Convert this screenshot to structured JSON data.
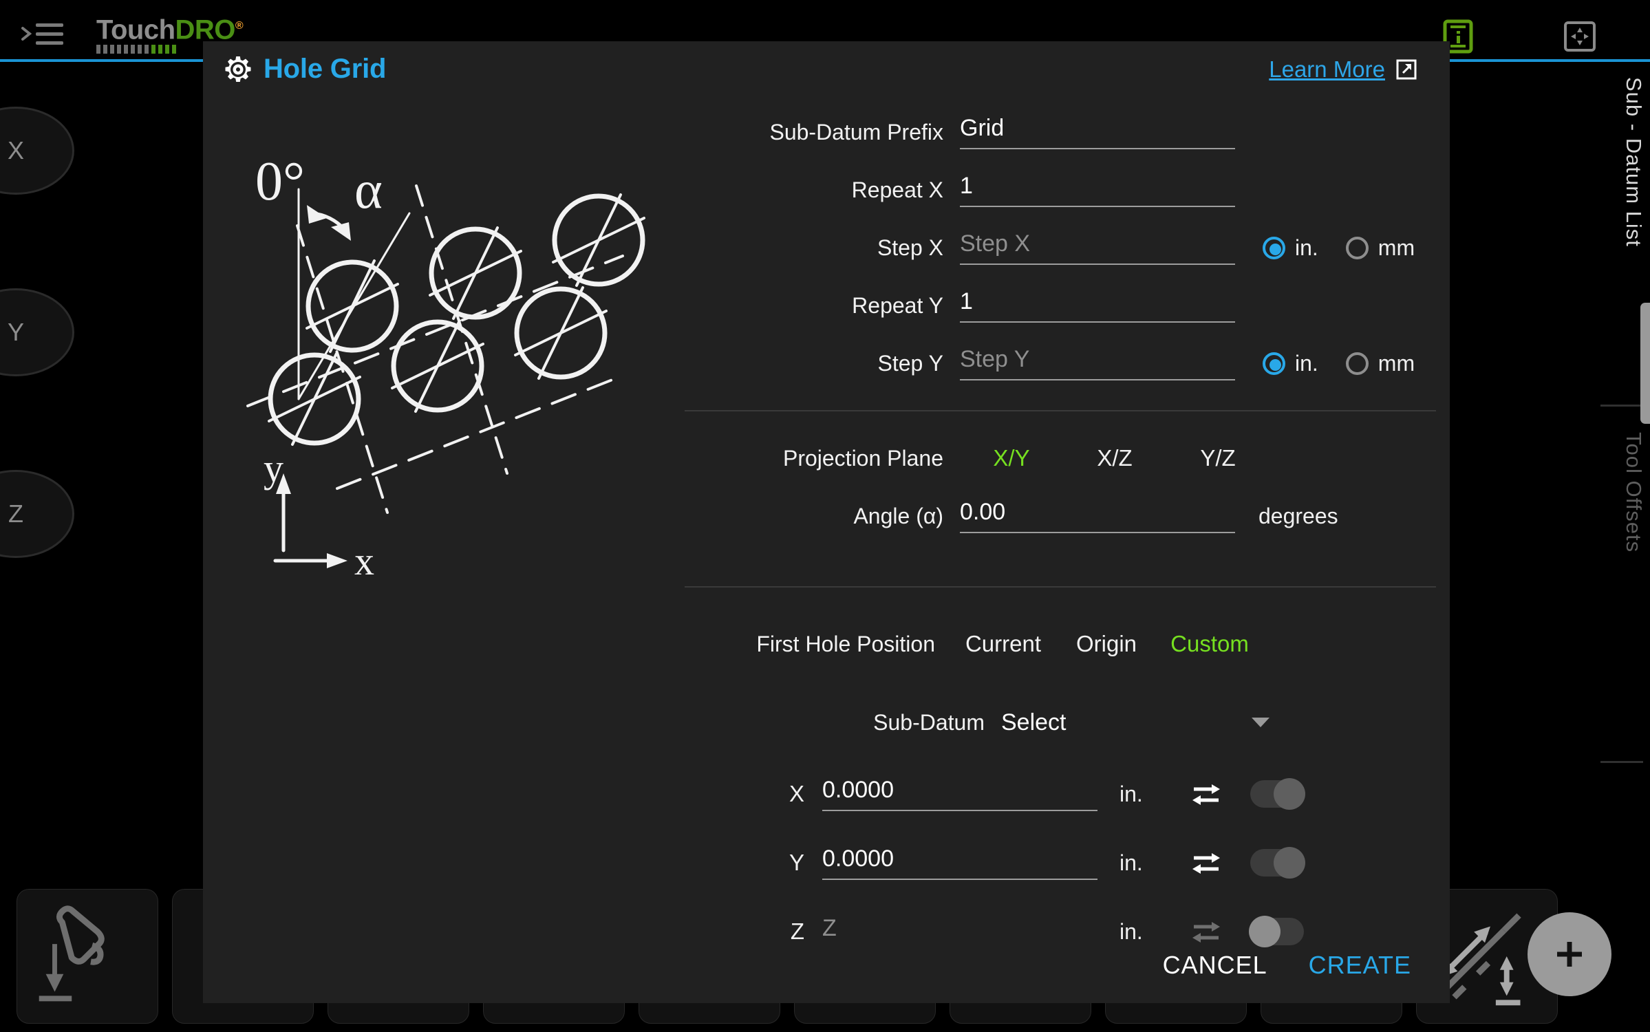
{
  "app": {
    "logo": {
      "part1": "Touch",
      "part2": "DRO",
      "reg": "®"
    },
    "icons": {
      "menu": "hamburger-menu-icon",
      "device": "device-info-icon",
      "fullscreen": "fullscreen-icon"
    },
    "axis_buttons": [
      "X",
      "Y",
      "Z"
    ],
    "side_tabs": [
      {
        "label": "Sub - Datum List",
        "active": true
      },
      {
        "label": "Tool Offsets",
        "active": false
      }
    ],
    "fab_label": "+"
  },
  "dialog": {
    "icon": "gear-icon",
    "title": "Hole Grid",
    "learn_more": {
      "label": "Learn More",
      "icon": "external-link-icon"
    },
    "illustration": {
      "angle_zero_label": "0°",
      "alpha_label": "α",
      "x_axis_label": "x",
      "y_axis_label": "y",
      "hole_count": 6
    },
    "fields": {
      "prefix": {
        "label": "Sub-Datum Prefix",
        "value": "Grid",
        "placeholder": ""
      },
      "repeat_x": {
        "label": "Repeat X",
        "value": "1",
        "placeholder": ""
      },
      "step_x": {
        "label": "Step X",
        "value": "",
        "placeholder": "Step X"
      },
      "repeat_y": {
        "label": "Repeat Y",
        "value": "1",
        "placeholder": ""
      },
      "step_y": {
        "label": "Step Y",
        "value": "",
        "placeholder": "Step Y"
      }
    },
    "units": {
      "inch_label": "in.",
      "mm_label": "mm",
      "step_x_selected": "in.",
      "step_y_selected": "in."
    },
    "projection": {
      "label": "Projection Plane",
      "options": [
        "X/Y",
        "X/Z",
        "Y/Z"
      ],
      "selected": "X/Y"
    },
    "angle": {
      "label": "Angle (α)",
      "value": "0.00",
      "unit": "degrees"
    },
    "first_hole": {
      "label": "First Hole Position",
      "options": [
        "Current",
        "Origin",
        "Custom"
      ],
      "selected": "Custom"
    },
    "subdatum": {
      "label": "Sub-Datum",
      "value": "Select"
    },
    "coords": [
      {
        "axis": "X",
        "value": "0.0000",
        "placeholder": "X",
        "unit": "in.",
        "toggle": "on",
        "swap_enabled": true
      },
      {
        "axis": "Y",
        "value": "0.0000",
        "placeholder": "Y",
        "unit": "in.",
        "toggle": "on",
        "swap_enabled": true
      },
      {
        "axis": "Z",
        "value": "",
        "placeholder": "Z",
        "unit": "in.",
        "toggle": "off",
        "swap_enabled": false
      }
    ],
    "buttons": {
      "cancel": "CANCEL",
      "create": "CREATE"
    }
  },
  "colors": {
    "accent_blue": "#29a8e8",
    "accent_green": "#76e020",
    "logo_green": "#4a8f14",
    "dialog_bg": "#212121",
    "page_bg": "#000000"
  }
}
